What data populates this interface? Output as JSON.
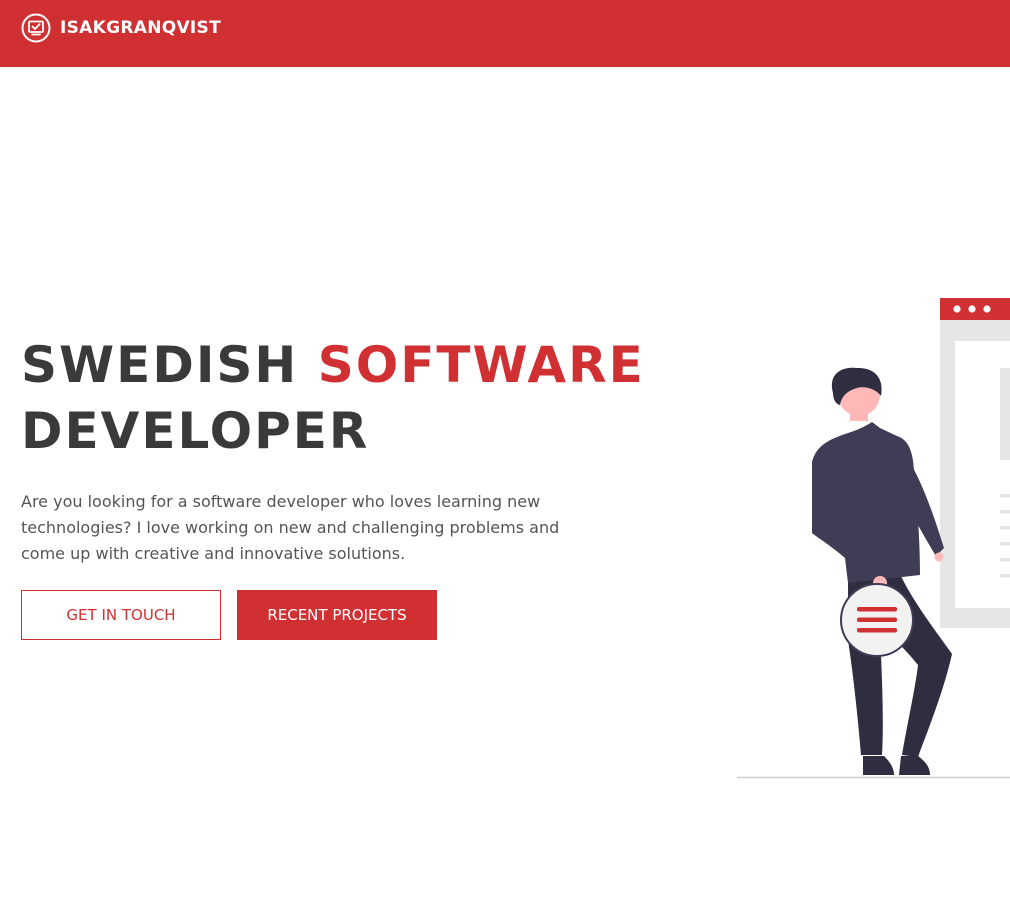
{
  "header": {
    "brand_name": "ISAKGRANQVIST",
    "brand_icon": "monitor-check-icon",
    "background_color": "#d13033"
  },
  "hero": {
    "title_part1": "SWEDISH ",
    "title_accent": "SOFTWARE",
    "title_part2": "DEVELOPER",
    "description": "Are you looking for a software developer who loves learning new technologies? I love working on new and challenging problems and come up with creative and innovative solutions.",
    "primary_cta": "GET IN TOUCH",
    "secondary_cta": "RECENT PROJECTS",
    "accent_color": "#d13033"
  },
  "illustration": {
    "subject": "developer-illustration",
    "menu_icon": "hamburger-menu-icon"
  }
}
